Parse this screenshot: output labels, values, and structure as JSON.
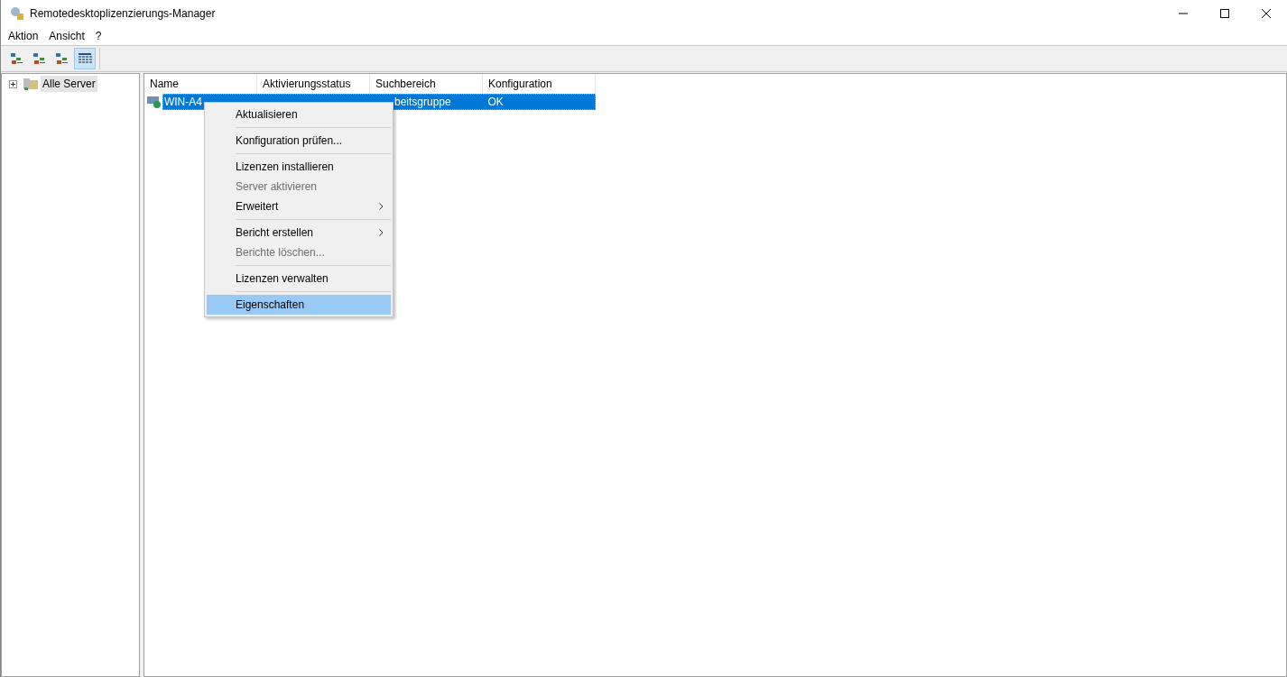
{
  "window": {
    "title": "Remotedesktoplizenzierungs-Manager"
  },
  "menu_bar": [
    "Aktion",
    "Ansicht",
    "?"
  ],
  "toolbar": [
    {
      "selected": false
    },
    {
      "selected": false
    },
    {
      "selected": false
    },
    {
      "selected": true
    }
  ],
  "tree": [
    {
      "label": "Alle Server",
      "expanded": false,
      "selected": true
    }
  ],
  "table": {
    "columns": [
      "Name",
      "Aktivierungsstatus",
      "Suchbereich",
      "Konfiguration"
    ],
    "rows": [
      {
        "cells": [
          "WIN-A4",
          "",
          "beitsgruppe",
          "OK"
        ],
        "selected": true
      }
    ]
  },
  "context_menu": [
    {
      "kind": "item",
      "label": "Aktualisieren",
      "disabled": false,
      "submenu": false,
      "selected": false
    },
    {
      "kind": "separator"
    },
    {
      "kind": "item",
      "label": "Konfiguration prüfen...",
      "disabled": false,
      "submenu": false,
      "selected": false
    },
    {
      "kind": "separator"
    },
    {
      "kind": "item",
      "label": "Lizenzen installieren",
      "disabled": false,
      "submenu": false,
      "selected": false
    },
    {
      "kind": "item",
      "label": "Server aktivieren",
      "disabled": true,
      "submenu": false,
      "selected": false
    },
    {
      "kind": "item",
      "label": "Erweitert",
      "disabled": false,
      "submenu": true,
      "selected": false
    },
    {
      "kind": "separator"
    },
    {
      "kind": "item",
      "label": "Bericht erstellen",
      "disabled": false,
      "submenu": true,
      "selected": false
    },
    {
      "kind": "item",
      "label": "Berichte löschen...",
      "disabled": true,
      "submenu": false,
      "selected": false
    },
    {
      "kind": "separator"
    },
    {
      "kind": "item",
      "label": "Lizenzen verwalten",
      "disabled": false,
      "submenu": false,
      "selected": false
    },
    {
      "kind": "separator"
    },
    {
      "kind": "item",
      "label": "Eigenschaften",
      "disabled": false,
      "submenu": false,
      "selected": true
    }
  ]
}
